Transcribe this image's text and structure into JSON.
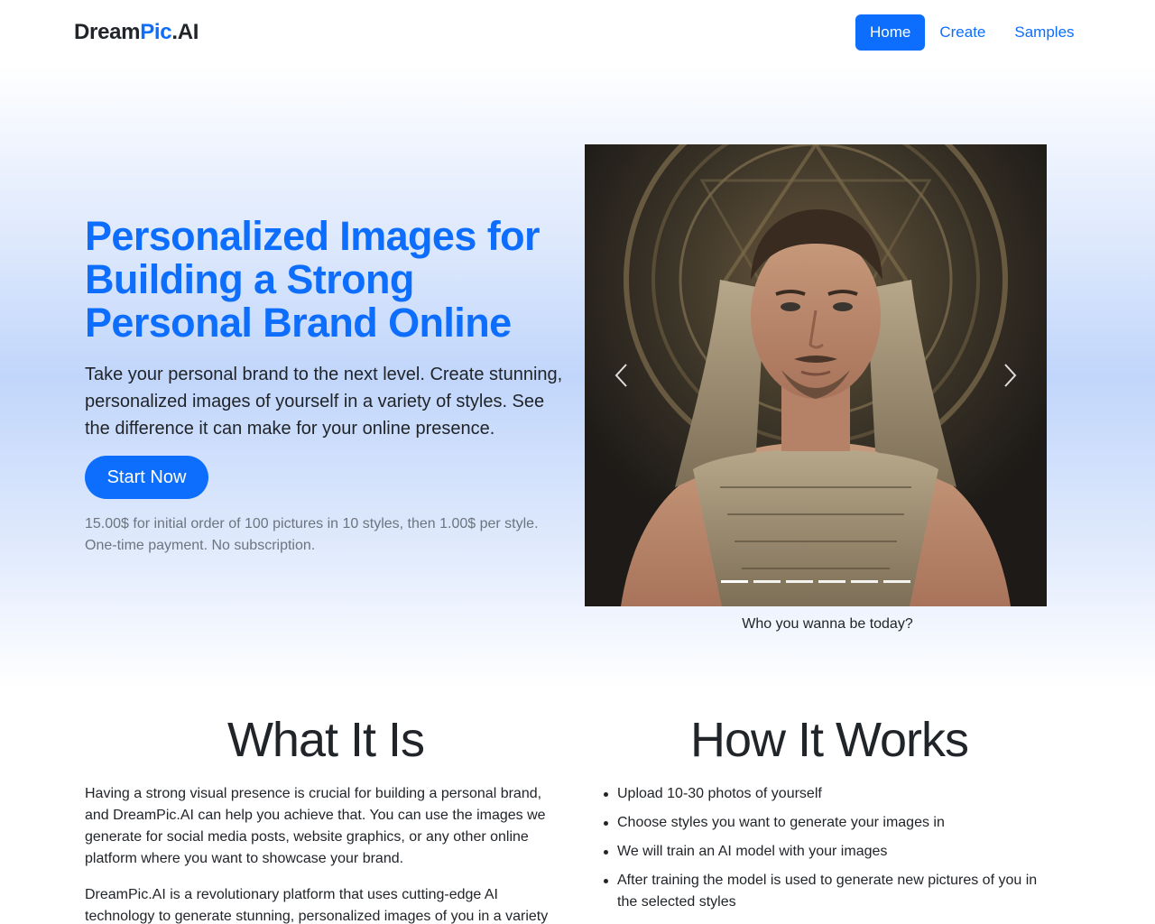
{
  "nav": {
    "brand_part1": "Dream",
    "brand_part2": "Pic",
    "brand_part3": ".AI",
    "links": [
      {
        "label": "Home",
        "active": true
      },
      {
        "label": "Create",
        "active": false
      },
      {
        "label": "Samples",
        "active": false
      }
    ]
  },
  "hero": {
    "title": "Personalized Images for Building a Strong Personal Brand Online",
    "lead": "Take your personal brand to the next level. Create stunning, personalized images of yourself in a variety of styles. See the difference it can make for your online presence.",
    "cta_label": "Start Now",
    "pricing_line1": "15.00$ for initial order of 100 pictures in 10 styles, then 1.00$ per style.",
    "pricing_line2": "One-time payment. No subscription."
  },
  "carousel": {
    "caption": "Who you wanna be today?",
    "slide_count": 6,
    "active_index": 0,
    "prev_icon": "chevron-left-icon",
    "next_icon": "chevron-right-icon"
  },
  "what": {
    "title": "What It Is",
    "paragraphs": [
      "Having a strong visual presence is crucial for building a personal brand, and DreamPic.AI can help you achieve that. You can use the images we generate for social media posts, website graphics, or any other online platform where you want to showcase your brand.",
      "DreamPic.AI is a revolutionary platform that uses cutting-edge AI technology to generate stunning, personalized images of you in a variety"
    ]
  },
  "how": {
    "title": "How It Works",
    "steps": [
      "Upload 10-30 photos of yourself",
      "Choose styles you want to generate your images in",
      "We will train an AI model with your images",
      "After training the model is used to generate new pictures of you in the selected styles"
    ]
  },
  "colors": {
    "primary": "#0d6efd",
    "text": "#212529",
    "muted": "#6c757d"
  }
}
